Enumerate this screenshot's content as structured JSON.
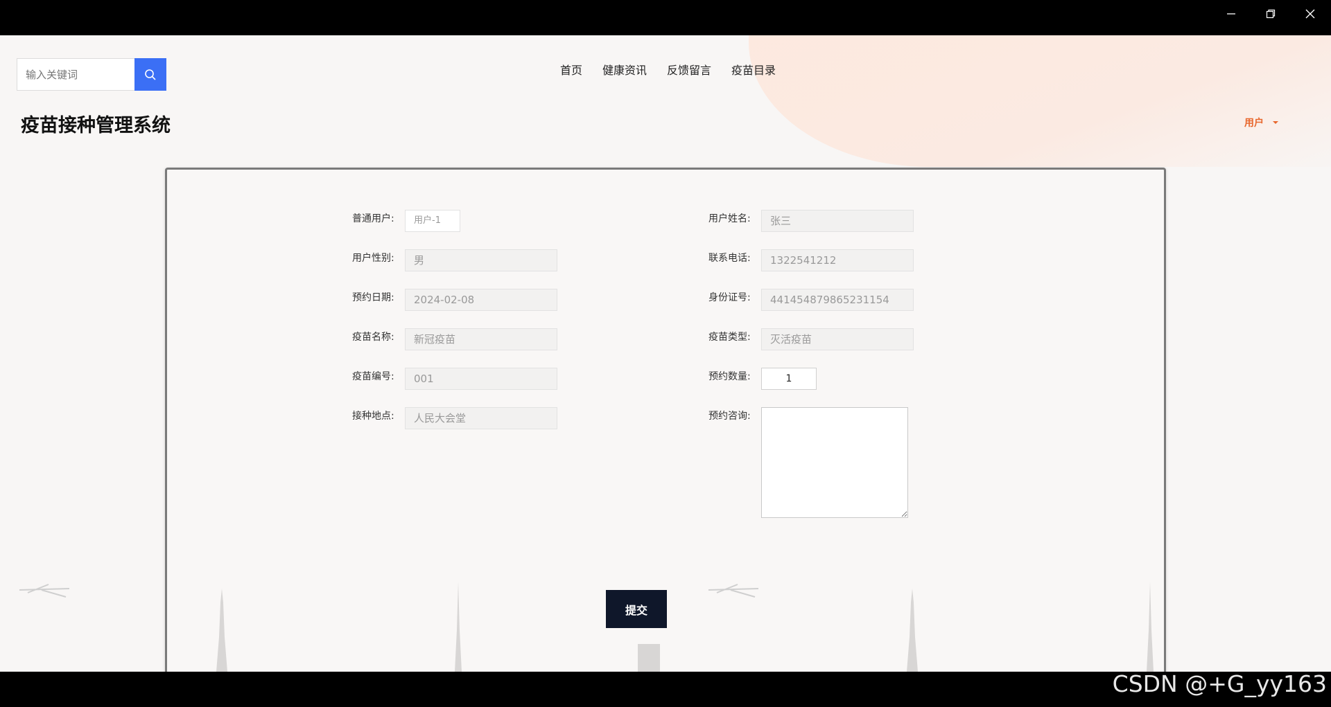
{
  "window": {
    "controls": [
      "minimize",
      "restore",
      "close"
    ]
  },
  "header": {
    "search": {
      "placeholder": "输入关键词"
    },
    "nav": [
      "首页",
      "健康资讯",
      "反馈留言",
      "疫苗目录"
    ],
    "title": "疫苗接种管理系统",
    "user_menu": {
      "label": "用户"
    },
    "accent_color": "#e8672d",
    "search_button_color": "#3b6ff5"
  },
  "form": {
    "fields_left": [
      {
        "label": "普通用户:",
        "value": "用户-1"
      },
      {
        "label": "用户性别:",
        "value": "男"
      },
      {
        "label": "预约日期:",
        "value": "2024-02-08"
      },
      {
        "label": "疫苗名称:",
        "value": "新冠疫苗"
      },
      {
        "label": "疫苗编号:",
        "value": "001"
      },
      {
        "label": "接种地点:",
        "value": "人民大会堂"
      }
    ],
    "fields_right": [
      {
        "label": "用户姓名:",
        "value": "张三"
      },
      {
        "label": "联系电话:",
        "value": "1322541212"
      },
      {
        "label": "身份证号:",
        "value": "441454879865231154"
      },
      {
        "label": "疫苗类型:",
        "value": "灭活疫苗"
      },
      {
        "label": "预约数量:",
        "value": "1"
      },
      {
        "label": "预约咨询:",
        "value": ""
      }
    ],
    "submit_label": "提交",
    "submit_color": "#0f172a"
  },
  "watermark": "CSDN @+G_yy163"
}
